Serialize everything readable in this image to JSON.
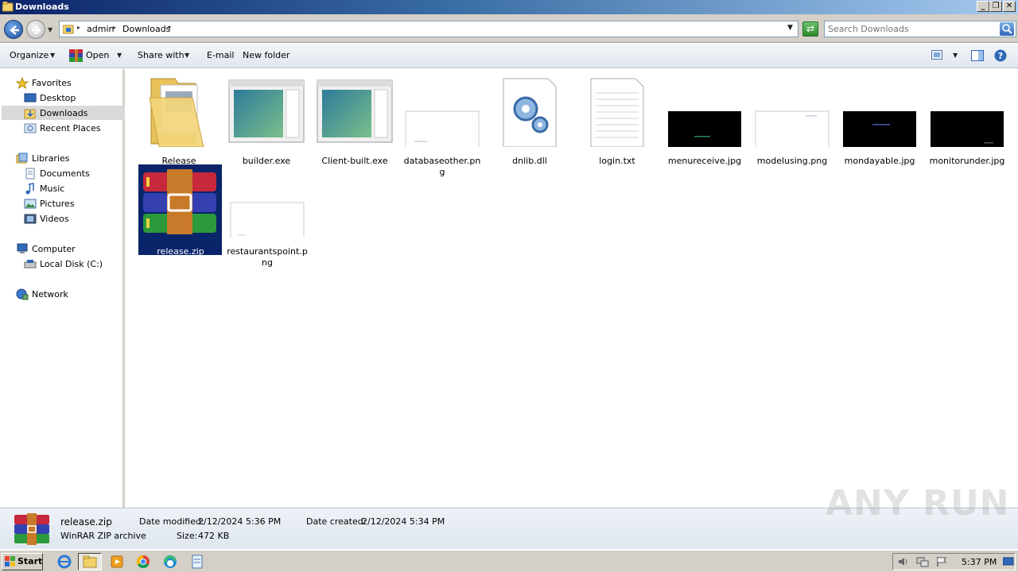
{
  "window": {
    "title": "Downloads"
  },
  "address": {
    "crumbs": [
      "admin",
      "Downloads"
    ],
    "search_placeholder": "Search Downloads"
  },
  "toolbar": {
    "organize": "Organize",
    "open": "Open",
    "share_with": "Share with",
    "email": "E-mail",
    "new_folder": "New folder"
  },
  "nav": {
    "favorites": "Favorites",
    "desktop": "Desktop",
    "downloads": "Downloads",
    "recent_places": "Recent Places",
    "libraries": "Libraries",
    "documents": "Documents",
    "music": "Music",
    "pictures": "Pictures",
    "videos": "Videos",
    "computer": "Computer",
    "local_disk": "Local Disk (C:)",
    "network": "Network"
  },
  "files": [
    {
      "name": "Release",
      "type": "folder"
    },
    {
      "name": "builder.exe",
      "type": "exe"
    },
    {
      "name": "Client-built.exe",
      "type": "exe"
    },
    {
      "name": "databaseother.png",
      "type": "white-image"
    },
    {
      "name": "dnlib.dll",
      "type": "dll"
    },
    {
      "name": "login.txt",
      "type": "txt"
    },
    {
      "name": "menureceive.jpg",
      "type": "black-image"
    },
    {
      "name": "modelusing.png",
      "type": "white-image"
    },
    {
      "name": "mondayable.jpg",
      "type": "black-image"
    },
    {
      "name": "monitorunder.jpg",
      "type": "black-image"
    },
    {
      "name": "release.zip",
      "type": "zip",
      "selected": true
    },
    {
      "name": "restaurantspoint.png",
      "type": "white-image"
    }
  ],
  "details": {
    "name": "release.zip",
    "type": "WinRAR ZIP archive",
    "modified_label": "Date modified:",
    "modified_value": "2/12/2024 5:36 PM",
    "created_label": "Date created:",
    "created_value": "2/12/2024 5:34 PM",
    "size_label": "Size:",
    "size_value": "472 KB"
  },
  "taskbar": {
    "start": "Start",
    "clock": "5:37 PM"
  },
  "watermark": "ANY RUN",
  "colors": {
    "selection": "#0a246a",
    "titlebar": "#0b246a"
  }
}
